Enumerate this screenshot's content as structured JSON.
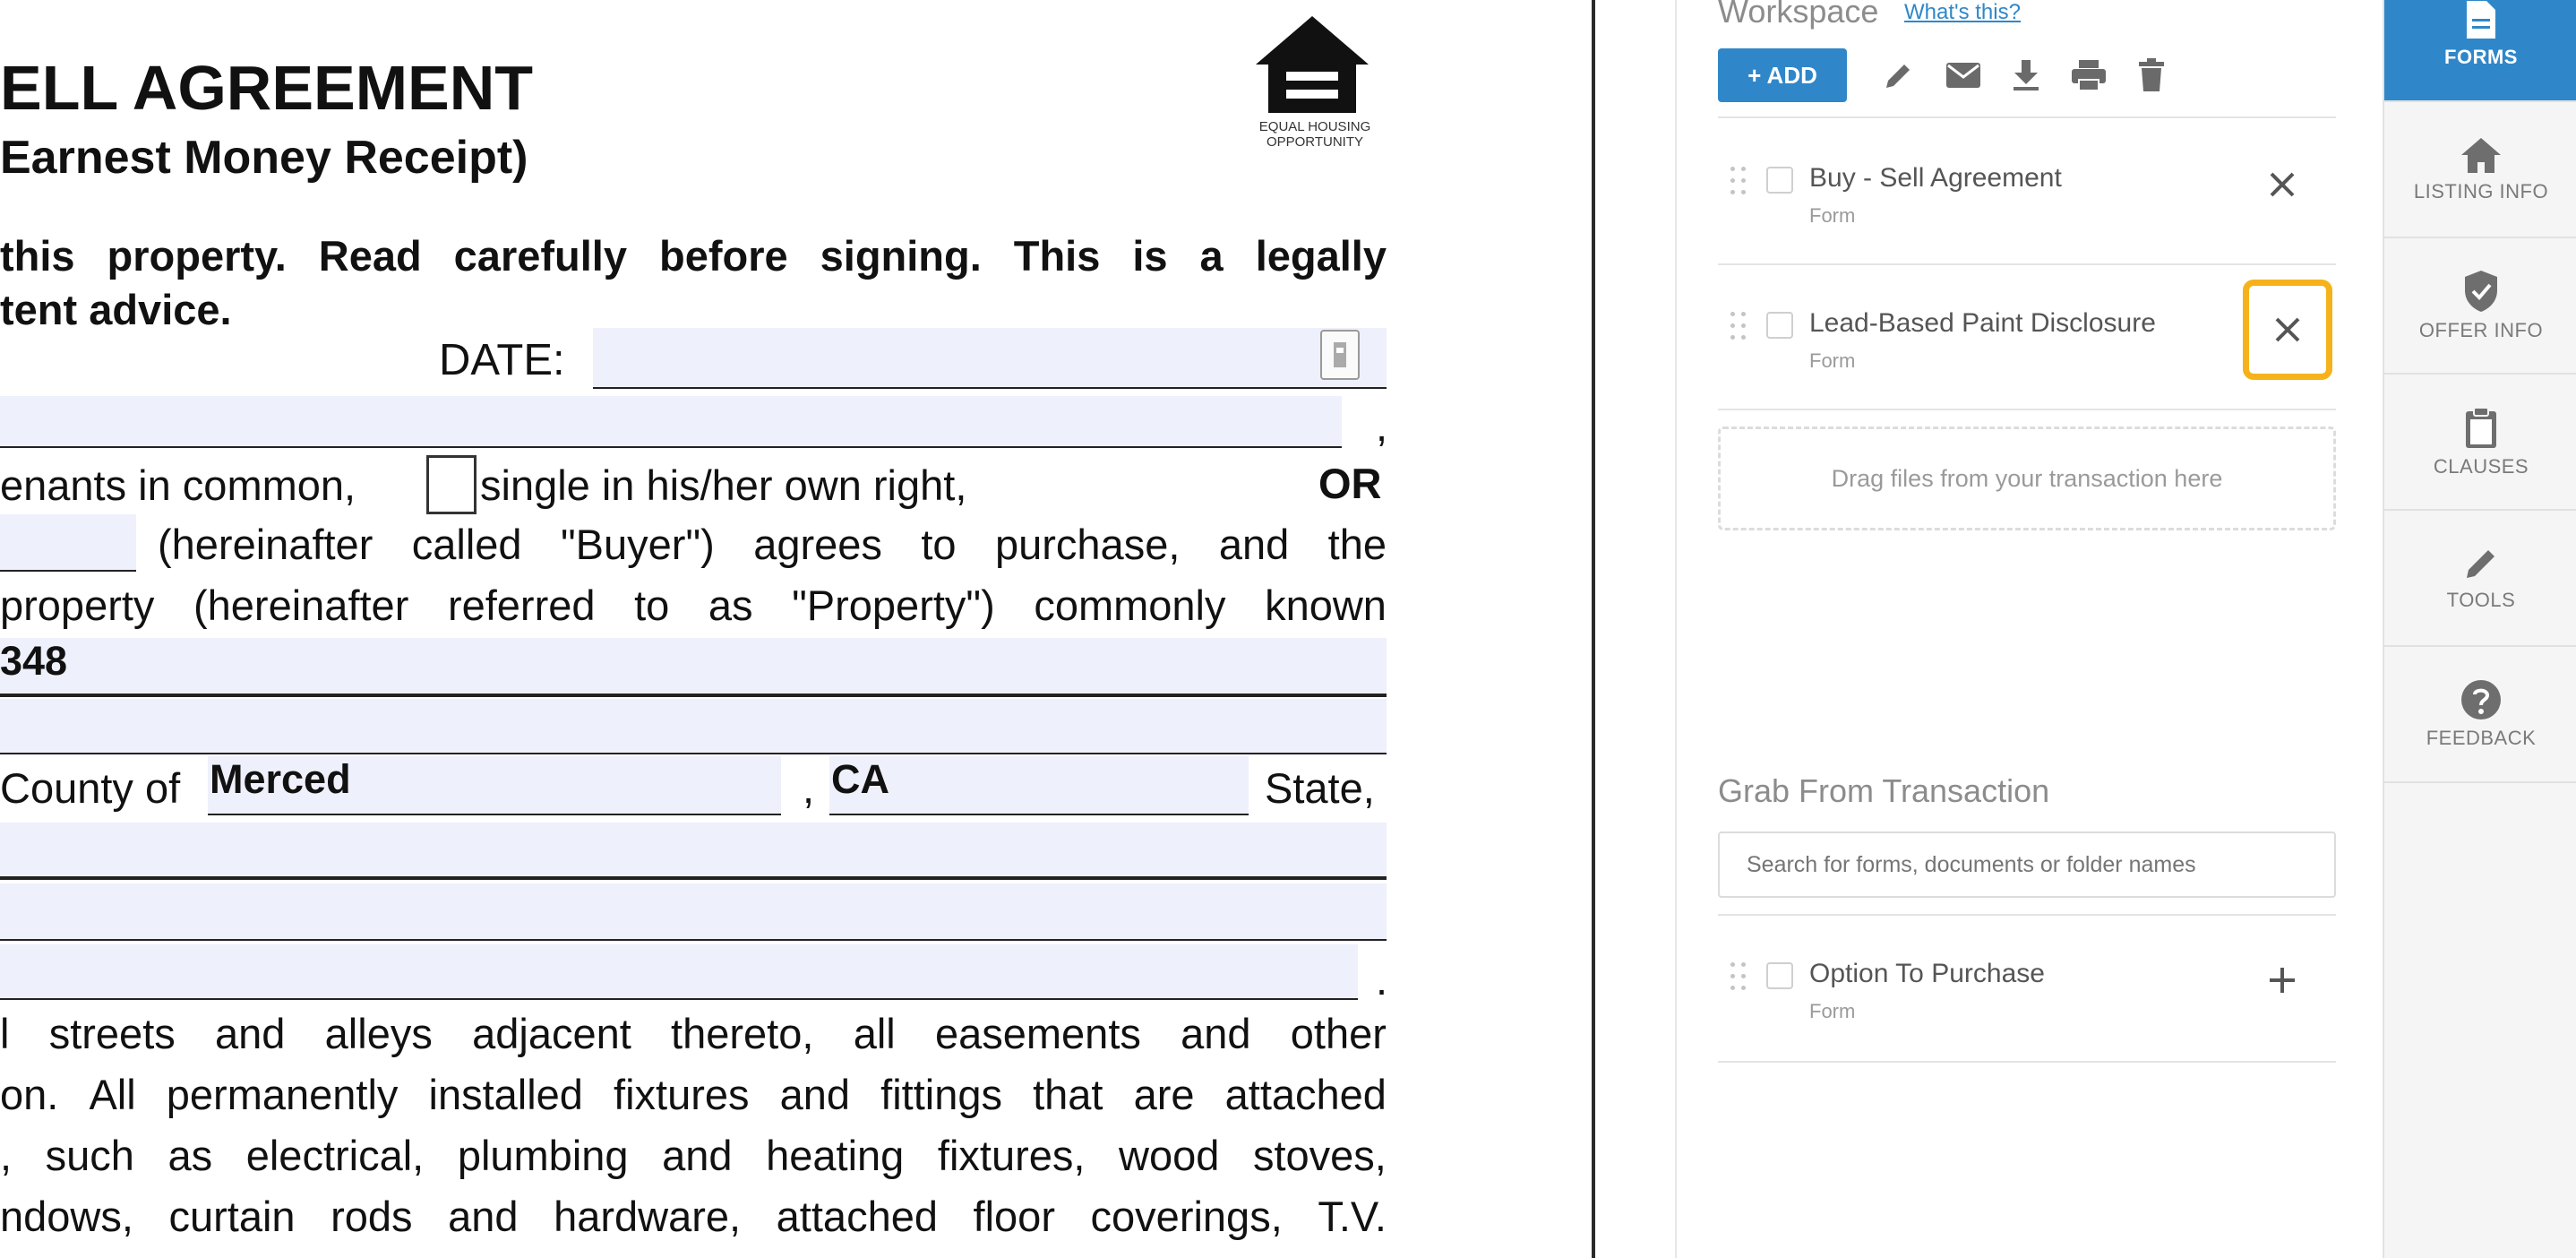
{
  "document": {
    "title_line1": "ELL AGREEMENT",
    "title_line2": "Earnest Money Receipt)",
    "eho_logo_text": "EQUAL HOUSING OPPORTUNITY",
    "warning_line1": "this property. Read carefully before signing. This is a legally",
    "warning_line2": "tent advice.",
    "date_label": "DATE:",
    "comma1": ",",
    "row_tenants": {
      "text": "enants in common,",
      "single": "single in his/her own right,",
      "or": "OR"
    },
    "row_buyer": {
      "text": "(hereinafter called \"Buyer\") agrees to purchase, and the"
    },
    "row_property": {
      "words": [
        "property",
        "(hereinafter",
        "referred",
        "to",
        "as",
        "\"Property\")",
        "commonly",
        "known"
      ]
    },
    "address_value": "348",
    "row_county": {
      "county_label": "County of",
      "county_value": "Merced",
      "comma": ",",
      "state_value": "CA",
      "state_label": "State,"
    },
    "period": ".",
    "row_streets": {
      "words": [
        "l",
        "streets",
        "and",
        "alleys",
        "adjacent",
        "thereto,",
        "all",
        "easements",
        "and",
        "other"
      ]
    },
    "row_on": {
      "words": [
        "on.",
        "All",
        "permanently",
        "installed",
        "fixtures",
        "and",
        "fittings",
        "that",
        "are",
        "attached"
      ]
    },
    "row_such": {
      "words": [
        ",",
        "such",
        "as",
        "electrical,",
        "plumbing",
        "and",
        "heating",
        "fixtures,",
        "wood",
        "stoves,"
      ]
    },
    "row_ndows": {
      "words": [
        "ndows,",
        "curtain",
        "rods",
        "and",
        "hardware,",
        "attached",
        "floor",
        "coverings,",
        "T.V."
      ]
    }
  },
  "workspace": {
    "title": "Workspace",
    "whats_this": "What's this?",
    "add_button": "+ ADD",
    "toolbar_icons": [
      "pencil-icon",
      "envelope-icon",
      "download-icon",
      "print-icon",
      "trash-icon"
    ],
    "items": [
      {
        "name": "Buy - Sell Agreement",
        "type": "Form"
      },
      {
        "name": "Lead-Based Paint Disclosure",
        "type": "Form"
      }
    ],
    "dropzone": "Drag files from your transaction here",
    "grab_title": "Grab From Transaction",
    "search_placeholder": "Search for forms, documents or folder names",
    "transaction_items": [
      {
        "name": "Option To Purchase",
        "type": "Form"
      }
    ],
    "highlight_color": "#f6b21b"
  },
  "nav": {
    "items": [
      {
        "label": "FORMS",
        "icon": "document-icon",
        "active": true
      },
      {
        "label": "LISTING INFO",
        "icon": "home-icon",
        "active": false
      },
      {
        "label": "OFFER INFO",
        "icon": "shield-check-icon",
        "active": false
      },
      {
        "label": "CLAUSES",
        "icon": "clipboard-icon",
        "active": false
      },
      {
        "label": "TOOLS",
        "icon": "pencil-icon",
        "active": false
      },
      {
        "label": "FEEDBACK",
        "icon": "question-icon",
        "active": false
      }
    ],
    "active_color": "#2f87c9"
  }
}
